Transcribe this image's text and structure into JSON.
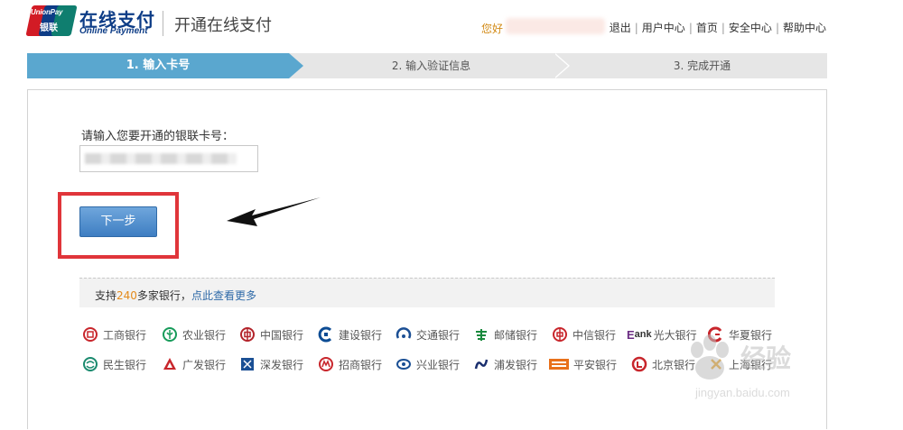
{
  "header": {
    "logo_text": "UnionPay",
    "logo_cn": "银联",
    "brand_cn": "在线支付",
    "brand_en": "Online Payment",
    "page_title": "开通在线支付",
    "greeting": "您好",
    "nav": [
      "退出",
      "用户中心",
      "首页",
      "安全中心",
      "帮助中心"
    ]
  },
  "steps": [
    {
      "label": "1. 输入卡号",
      "active": true
    },
    {
      "label": "2. 输入验证信息",
      "active": false
    },
    {
      "label": "3. 完成开通",
      "active": false
    }
  ],
  "form": {
    "card_label": "请输入您要开通的银联卡号：",
    "next_button": "下一步"
  },
  "support": {
    "prefix": "支持",
    "count": "240",
    "suffix": "多家银行，",
    "link": "点此查看更多"
  },
  "banks_row1": [
    "工商银行",
    "农业银行",
    "中国银行",
    "建设银行",
    "交通银行",
    "邮储银行",
    "中信银行",
    "光大银行",
    "华夏银行"
  ],
  "banks_row2": [
    "民生银行",
    "广发银行",
    "深发银行",
    "招商银行",
    "兴业银行",
    "浦发银行",
    "平安银行",
    "北京银行",
    "上海银行"
  ],
  "watermark": {
    "text": "经验",
    "url": "jingyan.baidu.com"
  },
  "colors": {
    "step_active": "#5aa7cf",
    "button": "#3e7ec2",
    "highlight_box": "#e0353a",
    "count_color": "#e48a1a",
    "brand": "#0d3c86"
  }
}
